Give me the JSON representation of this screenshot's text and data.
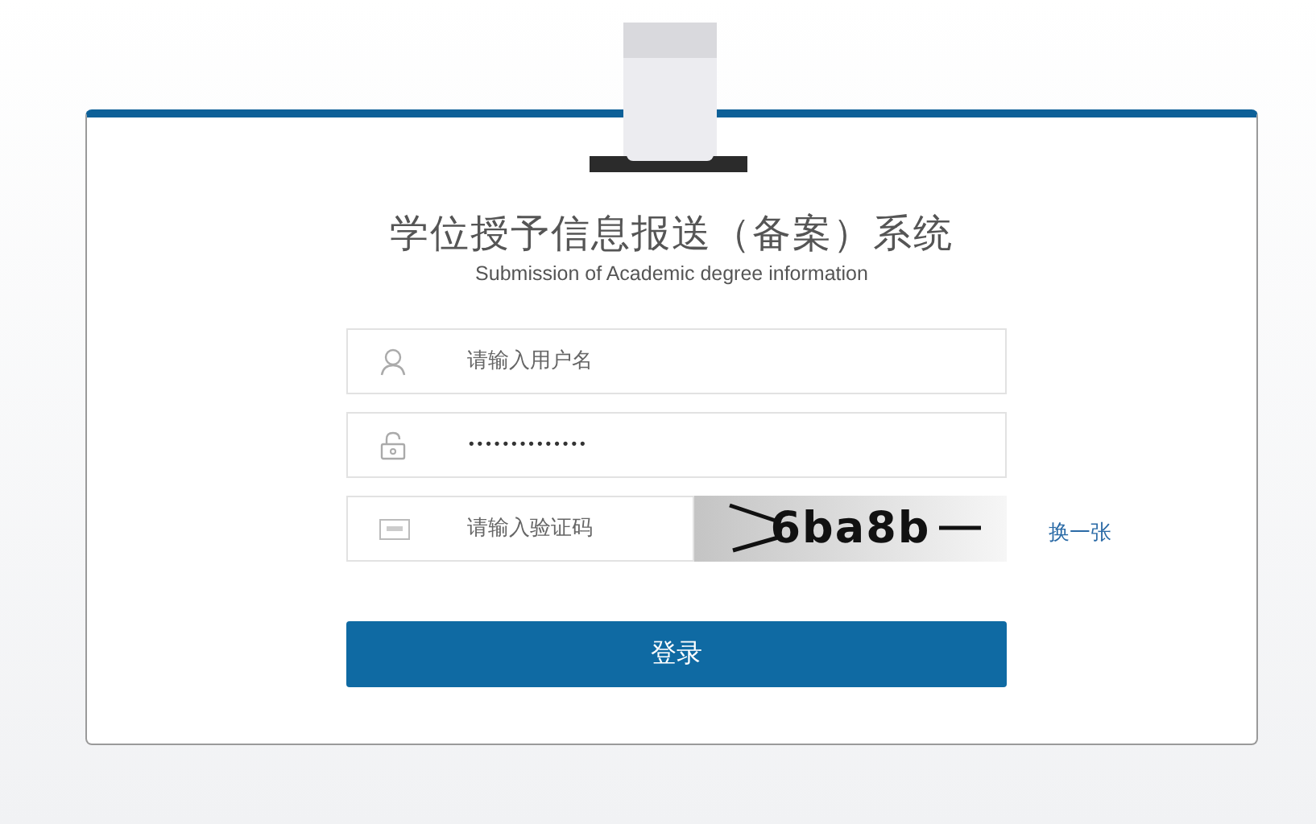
{
  "title": "学位授予信息报送（备案）系统",
  "subtitle": "Submission of Academic degree information",
  "username": {
    "placeholder": "请输入用户名"
  },
  "password": {
    "value": "••••••••••••••"
  },
  "captcha": {
    "placeholder": "请输入验证码",
    "code": "6ba8b",
    "refresh": "换一张"
  },
  "login_button": "登录"
}
